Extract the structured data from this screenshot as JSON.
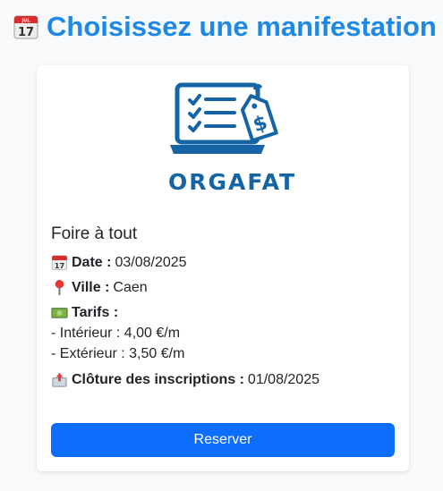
{
  "header": {
    "title": "Choisissez une manifestation :",
    "icon": "calendar-icon"
  },
  "card": {
    "logo_text": "ORGAFAT",
    "event_name": "Foire à tout",
    "date_label": "Date :",
    "date_value": "03/08/2025",
    "city_label": "Ville :",
    "city_value": "Caen",
    "tarifs_label": "Tarifs :",
    "tarif_interior": "- Intérieur : 4,00 €/m",
    "tarif_exterior": "- Extérieur : 3,50 €/m",
    "closing_label": "Clôture des inscriptions :",
    "closing_value": "01/08/2025",
    "button_label": "Reserver"
  },
  "colors": {
    "title": "#1e88e5",
    "button": "#0d6efd",
    "logo": "#1565a6"
  }
}
